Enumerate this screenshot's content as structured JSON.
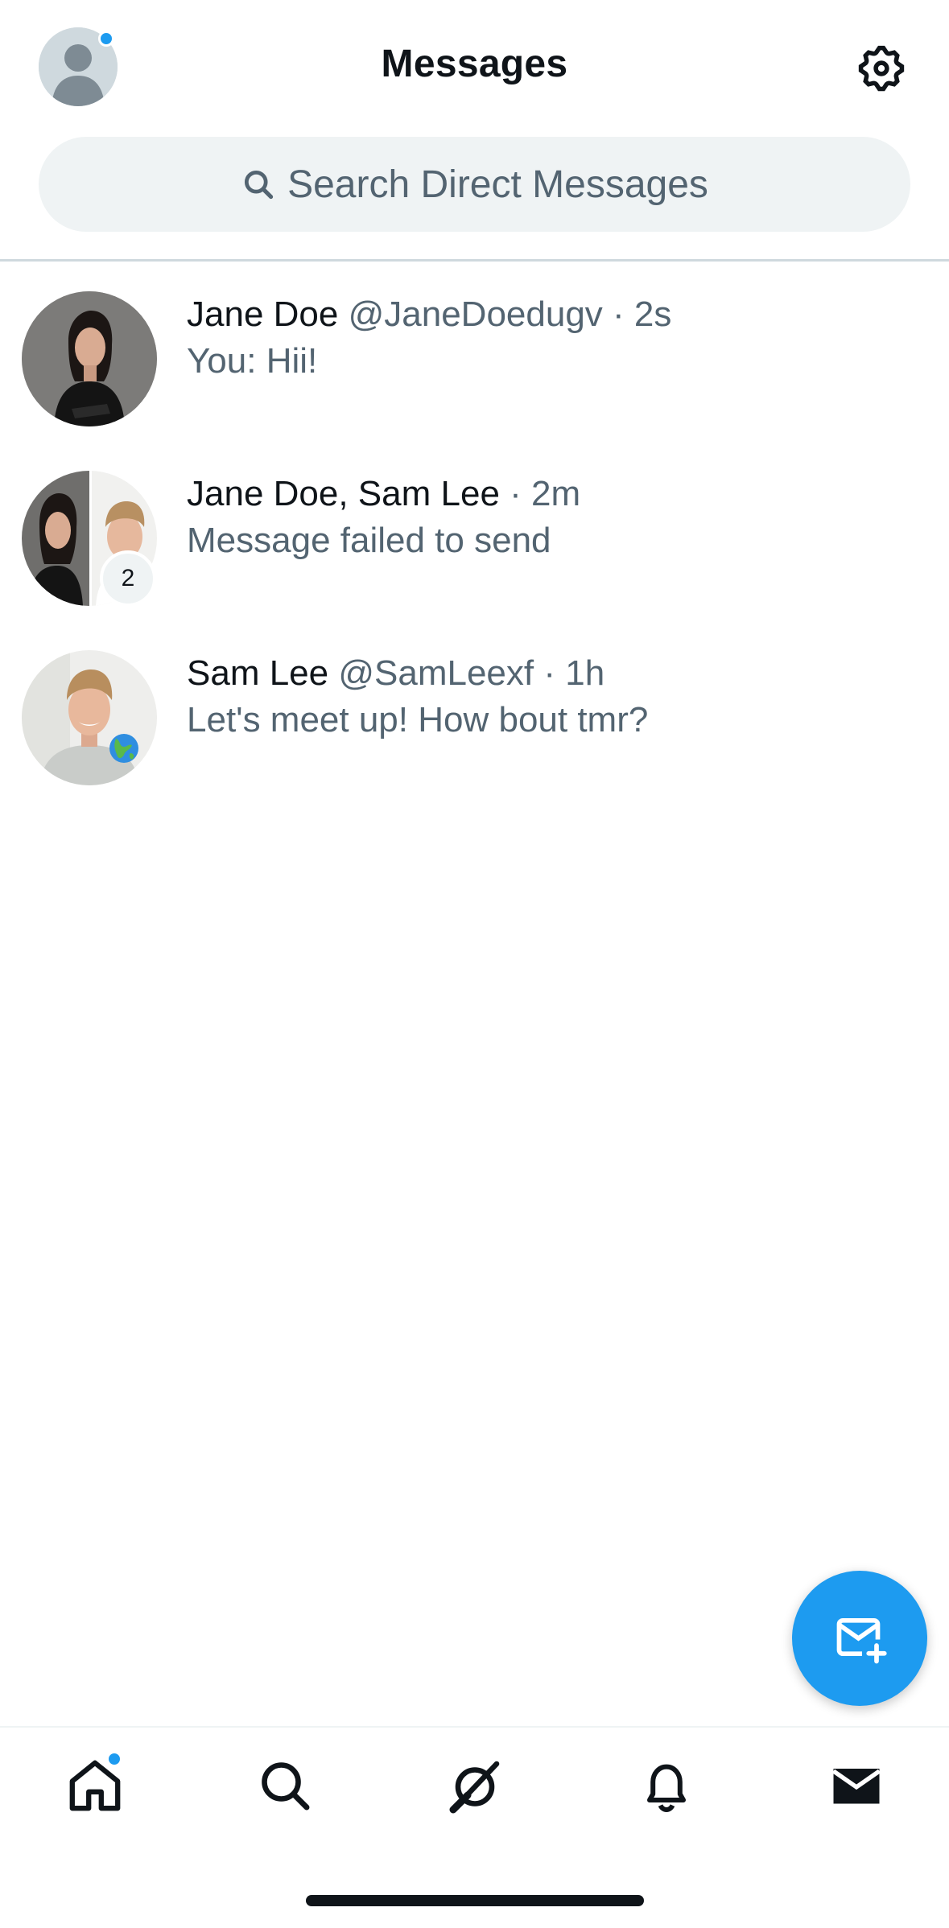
{
  "header": {
    "title": "Messages"
  },
  "search": {
    "placeholder": "Search Direct Messages"
  },
  "conversations": [
    {
      "name": "Jane Doe",
      "handle": "@JaneDoedugv",
      "time": "· 2s",
      "preview": "You: Hii!",
      "avatar": "jane-photo"
    },
    {
      "name": "Jane Doe, Sam Lee",
      "handle": "",
      "time": "· 2m",
      "preview": "Message failed to send",
      "avatar": "group-photo",
      "participant_count": "2"
    },
    {
      "name": "Sam Lee",
      "handle": "@SamLeexf",
      "time": "· 1h",
      "preview": "Let's meet up! How bout tmr?",
      "avatar": "sam-photo"
    }
  ],
  "bottom_nav": {
    "items": [
      "home-icon",
      "search-icon",
      "spaces-icon",
      "notifications-icon",
      "messages-icon"
    ],
    "active": "messages-icon"
  },
  "colors": {
    "accent": "#1d9bf0",
    "text_primary": "#0f1419",
    "text_secondary": "#536471",
    "search_bg": "#eff3f4"
  }
}
